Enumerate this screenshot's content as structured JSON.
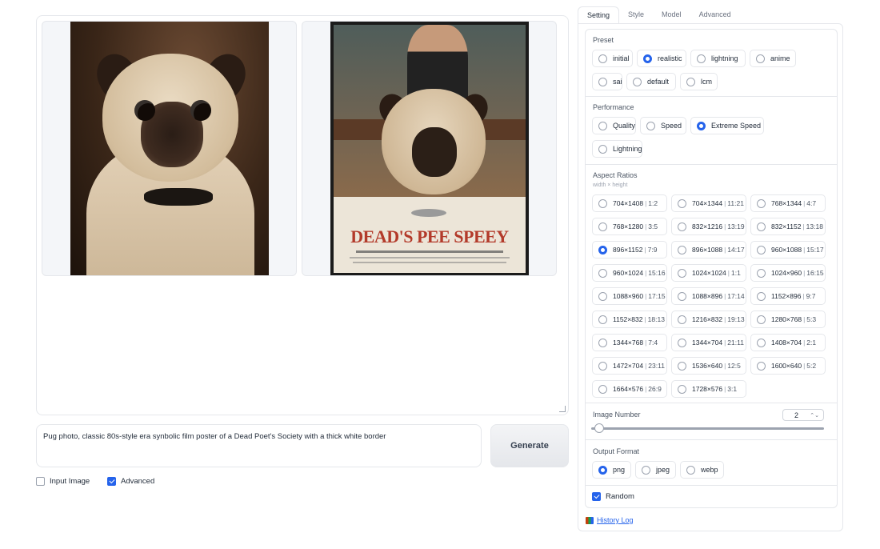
{
  "prompt": {
    "text": "Pug photo, classic 80s-style era synbolic film poster of a Dead Poet's Society with a thick white border"
  },
  "generate_label": "Generate",
  "options": {
    "input_image_label": "Input Image",
    "input_image_checked": false,
    "advanced_label": "Advanced",
    "advanced_checked": true
  },
  "gallery": {
    "poster_title": "DEAD'S PEE SPEEY"
  },
  "tabs": [
    {
      "label": "Setting",
      "active": true
    },
    {
      "label": "Style",
      "active": false
    },
    {
      "label": "Model",
      "active": false
    },
    {
      "label": "Advanced",
      "active": false
    }
  ],
  "preset": {
    "label": "Preset",
    "options": [
      "initial",
      "realistic",
      "lightning",
      "anime",
      "sai",
      "default",
      "lcm"
    ],
    "selected": "realistic"
  },
  "performance": {
    "label": "Performance",
    "options": [
      "Quality",
      "Speed",
      "Extreme Speed",
      "Lightning"
    ],
    "selected": "Extreme Speed"
  },
  "aspect_ratios": {
    "label": "Aspect Ratios",
    "sublabel": "width × height",
    "selected": "896×1152",
    "items": [
      {
        "size": "704×1408",
        "ratio": "1:2"
      },
      {
        "size": "704×1344",
        "ratio": "11:21"
      },
      {
        "size": "768×1344",
        "ratio": "4:7"
      },
      {
        "size": "768×1280",
        "ratio": "3:5"
      },
      {
        "size": "832×1216",
        "ratio": "13:19"
      },
      {
        "size": "832×1152",
        "ratio": "13:18"
      },
      {
        "size": "896×1152",
        "ratio": "7:9"
      },
      {
        "size": "896×1088",
        "ratio": "14:17"
      },
      {
        "size": "960×1088",
        "ratio": "15:17"
      },
      {
        "size": "960×1024",
        "ratio": "15:16"
      },
      {
        "size": "1024×1024",
        "ratio": "1:1"
      },
      {
        "size": "1024×960",
        "ratio": "16:15"
      },
      {
        "size": "1088×960",
        "ratio": "17:15"
      },
      {
        "size": "1088×896",
        "ratio": "17:14"
      },
      {
        "size": "1152×896",
        "ratio": "9:7"
      },
      {
        "size": "1152×832",
        "ratio": "18:13"
      },
      {
        "size": "1216×832",
        "ratio": "19:13"
      },
      {
        "size": "1280×768",
        "ratio": "5:3"
      },
      {
        "size": "1344×768",
        "ratio": "7:4"
      },
      {
        "size": "1344×704",
        "ratio": "21:11"
      },
      {
        "size": "1408×704",
        "ratio": "2:1"
      },
      {
        "size": "1472×704",
        "ratio": "23:11"
      },
      {
        "size": "1536×640",
        "ratio": "12:5"
      },
      {
        "size": "1600×640",
        "ratio": "5:2"
      },
      {
        "size": "1664×576",
        "ratio": "26:9"
      },
      {
        "size": "1728×576",
        "ratio": "3:1"
      }
    ]
  },
  "image_number": {
    "label": "Image Number",
    "value": "2"
  },
  "output_format": {
    "label": "Output Format",
    "options": [
      "png",
      "jpeg",
      "webp"
    ],
    "selected": "png"
  },
  "random": {
    "label": "Random",
    "checked": true
  },
  "history_log_label": "History Log",
  "colors": {
    "accent": "#2563eb",
    "border": "#e5e7eb"
  }
}
